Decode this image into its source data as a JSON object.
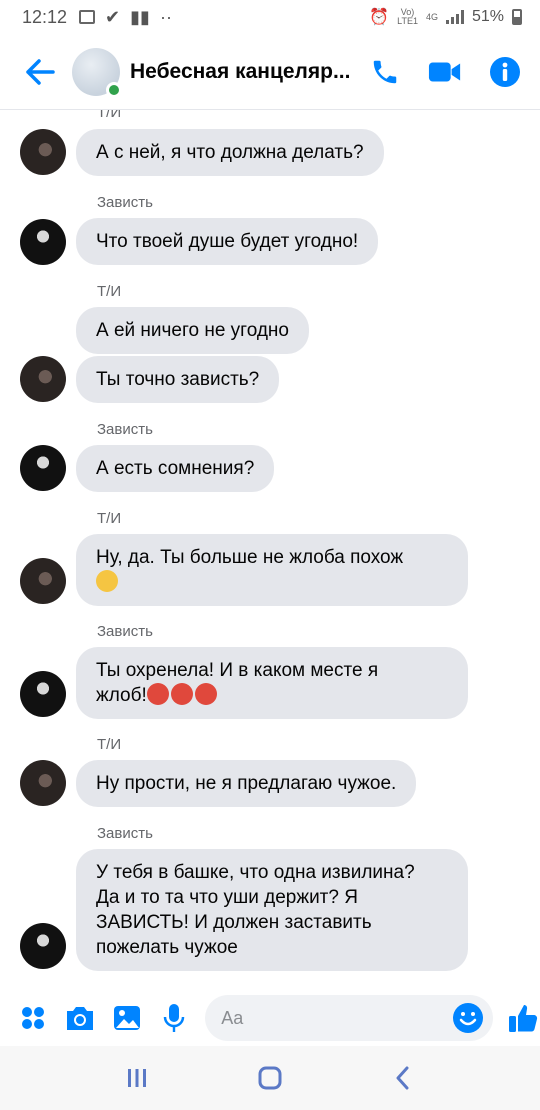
{
  "status_bar": {
    "time": "12:12",
    "network_top": "Vo)",
    "network_bottom": "LTE1",
    "net_type": "4G",
    "battery": "51%"
  },
  "header": {
    "title": "Небесная канцеляр...",
    "accent": "#0084ff",
    "online_color": "#31a24c"
  },
  "messages": [
    {
      "sender": "Т/И",
      "text": "А с ней, я что должна делать?"
    },
    {
      "sender": "Зависть",
      "text": "Что твоей душе будет угодно!"
    },
    {
      "sender": "Т/И",
      "text": "А ей ничего не угодно"
    },
    {
      "text": "Ты точно зависть?"
    },
    {
      "sender": "Зависть",
      "text": "А есть сомнения?"
    },
    {
      "sender": "Т/И",
      "line1": "Ну, да. Ты больше не жлоба похож",
      "emoji": "thinking-face"
    },
    {
      "sender": "Зависть",
      "line1": "Ты охренела! И в каком месте я",
      "line2": "жлоб!",
      "emoji": "angry-face"
    },
    {
      "sender": "Т/И",
      "text": "Ну прости, не я предлагаю чужое."
    },
    {
      "sender": "Зависть",
      "line1": "У тебя в башке, что одна извилина?",
      "line2": "Да и то та что уши держит? Я",
      "line3": "ЗАВИСТЬ! И должен заставить",
      "line4": "пожелать чужое"
    }
  ],
  "composer": {
    "placeholder": "Aa"
  }
}
